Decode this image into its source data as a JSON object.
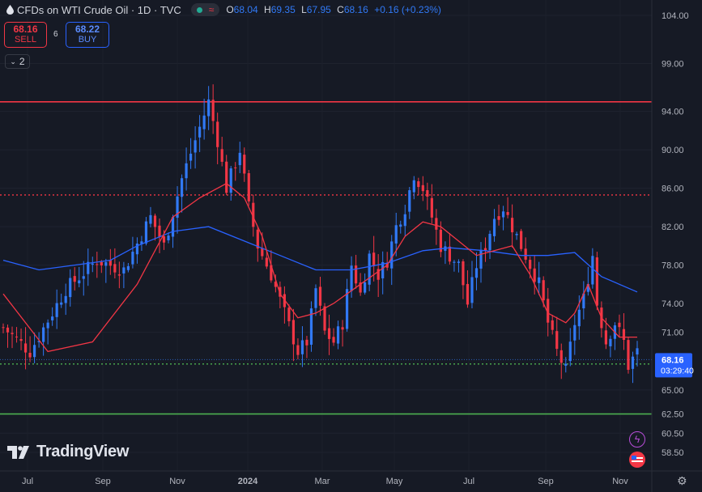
{
  "header": {
    "title": "CFDs on WTI Crude Oil · 1D · TVC",
    "open_label": "O",
    "open": "68.04",
    "high_label": "H",
    "high": "69.35",
    "low_label": "L",
    "low": "67.95",
    "close_label": "C",
    "close": "68.16",
    "change": "+0.16 (+0.23%)"
  },
  "trade": {
    "sell_price": "68.16",
    "sell_label": "SELL",
    "spread": "6",
    "buy_price": "68.22",
    "buy_label": "BUY"
  },
  "indicators_collapsed_count": "2",
  "brand": "TradingView",
  "icons": [
    "oil-drop-icon",
    "market-open-dot-icon",
    "wave-icon",
    "collapse-chevron-icon",
    "flash-icon",
    "us-flag-icon",
    "settings-icon"
  ],
  "colors": {
    "up": "#3179f5",
    "down": "#f23645",
    "ma_fast": "#f23645",
    "ma_slow": "#2962ff",
    "resistance": "#f23645",
    "support": "#22ab94",
    "support_strong": "#4caf50"
  },
  "chart_data": {
    "type": "candlestick",
    "ylim": [
      56.5,
      105.5
    ],
    "y_ticks": [
      "104.00",
      "99.00",
      "94.00",
      "90.00",
      "86.00",
      "82.00",
      "78.00",
      "74.00",
      "71.00",
      "65.00",
      "62.50",
      "60.50",
      "58.50"
    ],
    "x_ticks": [
      "Jul",
      "Sep",
      "Nov",
      "2024",
      "Mar",
      "May",
      "Jul",
      "Sep",
      "Nov"
    ],
    "price_path": [
      [
        0,
        71.5
      ],
      [
        6,
        69
      ],
      [
        14,
        75.5
      ],
      [
        21,
        78.5
      ],
      [
        27,
        77.5
      ],
      [
        33,
        83
      ],
      [
        36,
        80
      ],
      [
        40,
        87
      ],
      [
        43,
        91
      ],
      [
        46,
        95
      ],
      [
        48,
        91
      ],
      [
        50,
        86
      ],
      [
        53,
        90
      ],
      [
        55,
        84
      ],
      [
        57,
        80
      ],
      [
        60,
        77
      ],
      [
        63,
        73
      ],
      [
        66,
        69
      ],
      [
        68,
        70
      ],
      [
        70,
        75.5
      ],
      [
        72,
        71
      ],
      [
        74,
        70
      ],
      [
        76,
        72
      ],
      [
        78,
        78
      ],
      [
        80,
        75
      ],
      [
        82,
        79
      ],
      [
        84,
        77
      ],
      [
        86,
        78.5
      ],
      [
        88,
        82
      ],
      [
        90,
        84
      ],
      [
        92,
        87.5
      ],
      [
        94,
        86
      ],
      [
        96,
        83
      ],
      [
        98,
        80
      ],
      [
        100,
        79
      ],
      [
        102,
        78
      ],
      [
        104,
        74
      ],
      [
        106,
        78
      ],
      [
        108,
        80
      ],
      [
        110,
        83
      ],
      [
        112,
        84
      ],
      [
        114,
        82
      ],
      [
        116,
        80
      ],
      [
        118,
        78
      ],
      [
        120,
        76
      ],
      [
        122,
        72
      ],
      [
        124,
        69
      ],
      [
        126,
        67
      ],
      [
        128,
        72
      ],
      [
        130,
        74.5
      ],
      [
        132,
        79
      ],
      [
        133,
        74
      ],
      [
        135,
        70
      ],
      [
        137,
        72
      ],
      [
        139,
        70
      ],
      [
        140,
        67.5
      ],
      [
        142,
        69
      ]
    ],
    "ma_fast": [
      [
        0,
        75
      ],
      [
        10,
        69
      ],
      [
        20,
        70
      ],
      [
        30,
        76
      ],
      [
        38,
        83
      ],
      [
        44,
        85
      ],
      [
        50,
        86.5
      ],
      [
        54,
        85
      ],
      [
        58,
        81
      ],
      [
        62,
        75
      ],
      [
        66,
        72.5
      ],
      [
        70,
        73
      ],
      [
        74,
        74
      ],
      [
        80,
        76
      ],
      [
        86,
        78
      ],
      [
        90,
        81
      ],
      [
        94,
        82.5
      ],
      [
        98,
        82
      ],
      [
        102,
        80.5
      ],
      [
        106,
        79
      ],
      [
        110,
        79.5
      ],
      [
        114,
        80
      ],
      [
        118,
        77
      ],
      [
        122,
        73
      ],
      [
        126,
        72
      ],
      [
        128,
        73
      ],
      [
        131,
        76
      ],
      [
        134,
        72.5
      ],
      [
        138,
        70.5
      ],
      [
        142,
        70.5
      ]
    ],
    "ma_slow": [
      [
        0,
        78.5
      ],
      [
        8,
        77.5
      ],
      [
        16,
        78
      ],
      [
        24,
        78.5
      ],
      [
        30,
        80
      ],
      [
        38,
        81.5
      ],
      [
        46,
        82
      ],
      [
        54,
        80.5
      ],
      [
        62,
        79
      ],
      [
        70,
        77.5
      ],
      [
        78,
        77.5
      ],
      [
        86,
        78.2
      ],
      [
        94,
        79.5
      ],
      [
        100,
        79.8
      ],
      [
        108,
        79.5
      ],
      [
        116,
        79
      ],
      [
        122,
        79
      ],
      [
        128,
        79.3
      ],
      [
        134,
        76.8
      ],
      [
        142,
        75.2
      ]
    ],
    "n_bars": 143,
    "horizontal_levels": [
      {
        "value": 95.0,
        "style": "solid",
        "color": "#f23645"
      },
      {
        "value": 85.3,
        "style": "dotted",
        "color": "#f23645"
      },
      {
        "value": 67.7,
        "style": "dotted",
        "color": "#4caf50"
      },
      {
        "value": 62.5,
        "style": "solid",
        "color": "#4caf50"
      }
    ],
    "last_price": {
      "value": 68.16,
      "label": "68.16",
      "countdown": "03:29:40"
    }
  }
}
